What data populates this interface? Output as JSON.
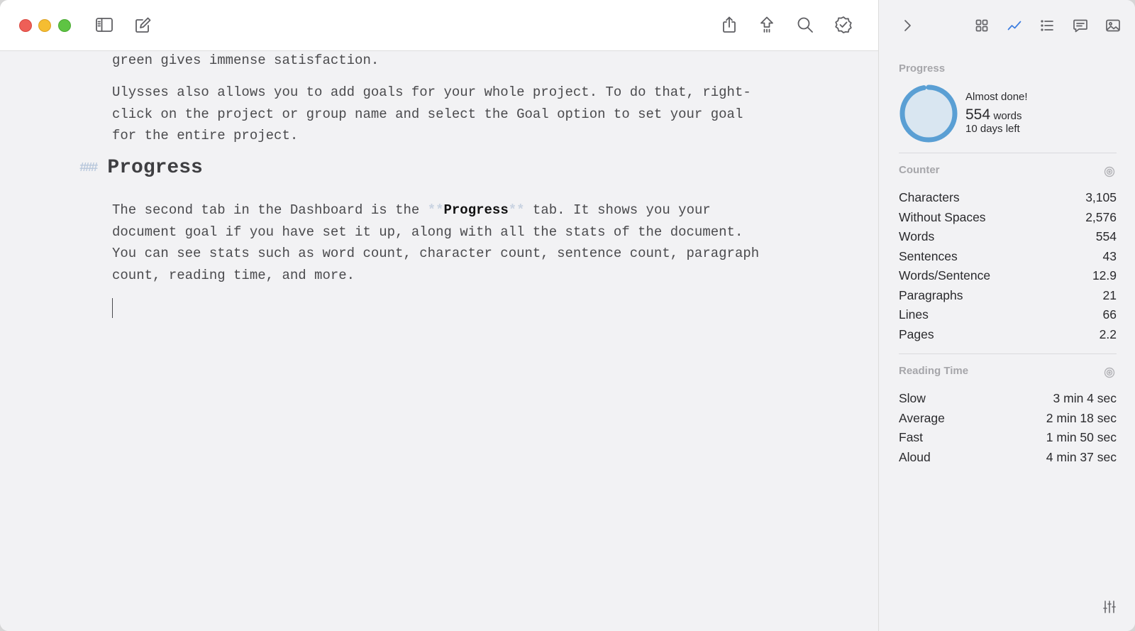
{
  "editor": {
    "paragraph_top": "green gives immense satisfaction.",
    "paragraph_1": "Ulysses also allows you to add goals for your whole project. To do that, right-click on the project or group name and select the Goal option to set your goal for the entire project.",
    "heading_marker": "###",
    "heading": "Progress",
    "paragraph_2_before": "The second tab in the Dashboard is the ",
    "bold_markup_open": "**",
    "bold_word": "Progress",
    "bold_markup_close": "**",
    "paragraph_2_after": " tab. It shows you your document goal if you have set it up, along with all the stats of the document. You can see stats such as word count, character count, sentence count, paragraph count, reading time, and more."
  },
  "sidebar": {
    "progress": {
      "title": "Progress",
      "status": "Almost done!",
      "word_count": "554",
      "word_unit": "words",
      "days_left": "10 days left",
      "fraction": 0.97,
      "ring_color": "#5a9fd4",
      "ring_fill": "#d9e6f1"
    },
    "counter": {
      "title": "Counter",
      "rows": [
        {
          "label": "Characters",
          "value": "3,105"
        },
        {
          "label": "Without Spaces",
          "value": "2,576"
        },
        {
          "label": "Words",
          "value": "554"
        },
        {
          "label": "Sentences",
          "value": "43"
        },
        {
          "label": "Words/Sentence",
          "value": "12.9"
        },
        {
          "label": "Paragraphs",
          "value": "21"
        },
        {
          "label": "Lines",
          "value": "66"
        },
        {
          "label": "Pages",
          "value": "2.2"
        }
      ]
    },
    "reading_time": {
      "title": "Reading Time",
      "rows": [
        {
          "label": "Slow",
          "value": "3 min 4 sec"
        },
        {
          "label": "Average",
          "value": "2 min 18 sec"
        },
        {
          "label": "Fast",
          "value": "1 min 50 sec"
        },
        {
          "label": "Aloud",
          "value": "4 min 37 sec"
        }
      ]
    }
  },
  "colors": {
    "accent": "#3b7de0",
    "close": "#ee5f57",
    "minimize": "#f5bd31",
    "zoom": "#5ec443"
  }
}
